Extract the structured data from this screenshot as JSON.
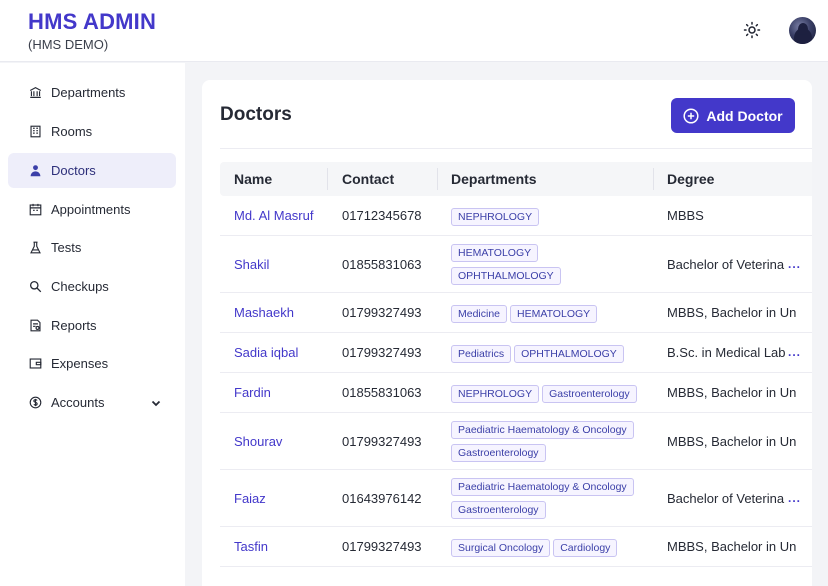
{
  "app": {
    "title": "HMS ADMIN",
    "subtitle": "(HMS DEMO)"
  },
  "icons": {
    "theme": "sun-icon",
    "add": "plus-circle-icon"
  },
  "colors": {
    "accent": "#4338ca",
    "active_bg": "#eeeefa",
    "tag_border": "#c9c4f2"
  },
  "sidebar": {
    "items": [
      {
        "label": "Departments",
        "icon": "bank-icon"
      },
      {
        "label": "Rooms",
        "icon": "building-icon"
      },
      {
        "label": "Doctors",
        "icon": "user-icon",
        "active": true
      },
      {
        "label": "Appointments",
        "icon": "calendar-icon"
      },
      {
        "label": "Tests",
        "icon": "flask-icon"
      },
      {
        "label": "Checkups",
        "icon": "search-icon"
      },
      {
        "label": "Reports",
        "icon": "report-icon"
      },
      {
        "label": "Expenses",
        "icon": "wallet-icon"
      },
      {
        "label": "Accounts",
        "icon": "dollar-icon",
        "has_submenu": true
      }
    ]
  },
  "main": {
    "title": "Doctors",
    "add_label": "Add Doctor",
    "columns": [
      "Name",
      "Contact",
      "Departments",
      "Degree"
    ],
    "rows": [
      {
        "name": "Md. Al Masruf",
        "contact": "01712345678",
        "departments": [
          [
            "NEPHROLOGY"
          ]
        ],
        "degree": "MBBS",
        "more": false
      },
      {
        "name": "Shakil",
        "contact": "01855831063",
        "departments": [
          [
            "HEMATOLOGY"
          ],
          [
            "OPHTHALMOLOGY"
          ]
        ],
        "degree": "Bachelor of Veterina",
        "more": true
      },
      {
        "name": "Mashaekh",
        "contact": "01799327493",
        "departments": [
          [
            "Medicine",
            "HEMATOLOGY"
          ]
        ],
        "degree": "MBBS, Bachelor in Un",
        "more": false
      },
      {
        "name": "Sadia iqbal",
        "contact": "01799327493",
        "departments": [
          [
            "Pediatrics",
            "OPHTHALMOLOGY"
          ]
        ],
        "degree": "B.Sc. in Medical Lab",
        "more": true
      },
      {
        "name": "Fardin",
        "contact": "01855831063",
        "departments": [
          [
            "NEPHROLOGY",
            "Gastroenterology"
          ]
        ],
        "degree": "MBBS, Bachelor in Un",
        "more": false
      },
      {
        "name": "Shourav",
        "contact": "01799327493",
        "departments": [
          [
            "Paediatric Haematology & Oncology"
          ],
          [
            "Gastroenterology"
          ]
        ],
        "degree": "MBBS, Bachelor in Un",
        "more": false
      },
      {
        "name": "Faiaz",
        "contact": "01643976142",
        "departments": [
          [
            "Paediatric Haematology & Oncology"
          ],
          [
            "Gastroenterology"
          ]
        ],
        "degree": "Bachelor of Veterina",
        "more": true
      },
      {
        "name": "Tasfin",
        "contact": "01799327493",
        "departments": [
          [
            "Surgical Oncology",
            "Cardiology"
          ]
        ],
        "degree": "MBBS, Bachelor in Un",
        "more": false
      }
    ]
  }
}
